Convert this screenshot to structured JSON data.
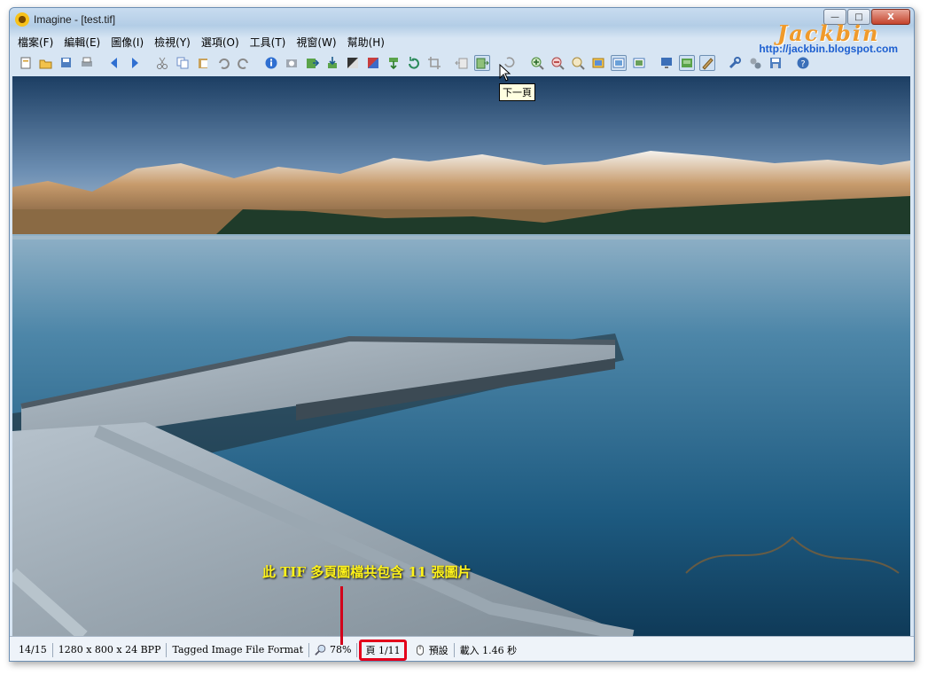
{
  "window": {
    "title": "Imagine - [test.tif]"
  },
  "window_buttons": {
    "minimize": "—",
    "maximize": "□",
    "close": "X"
  },
  "menu": [
    {
      "label": "檔案(F)"
    },
    {
      "label": "編輯(E)"
    },
    {
      "label": "圖像(I)"
    },
    {
      "label": "檢視(Y)"
    },
    {
      "label": "選項(O)"
    },
    {
      "label": "工具(T)"
    },
    {
      "label": "視窗(W)"
    },
    {
      "label": "幫助(H)"
    }
  ],
  "toolbar": {
    "icons": [
      "new-file-icon",
      "open-icon",
      "save-all-icon",
      "print-icon",
      "prev-file-icon",
      "next-file-icon",
      "cut-icon",
      "copy-icon",
      "paste-icon",
      "undo-icon",
      "redo-icon",
      "info-icon",
      "capture-icon",
      "export-icon",
      "import-icon",
      "contrast-icon",
      "color-icon",
      "move-down-icon",
      "rotate-icon",
      "crop-icon",
      "prev-page-icon",
      "next-page-icon",
      "refresh-icon",
      "zoom-in-icon",
      "zoom-out-icon",
      "zoom-fit-icon",
      "view-icon",
      "slideshow-icon",
      "fullscreen-icon",
      "monitor-icon",
      "thumbnail-icon",
      "edit-tool-icon",
      "settings-icon",
      "plugins-icon",
      "save-icon",
      "help-icon"
    ],
    "tooltip": "下一頁"
  },
  "brand": {
    "logo": "Jackbin",
    "url": "http://jackbin.blogspot.com"
  },
  "canvas": {
    "annotation": "此 TIF 多頁圖檔共包含 11 張圖片"
  },
  "status": {
    "file_index": "14/15",
    "dimensions": "1280 x 800 x 24 BPP",
    "format": "Tagged Image File Format",
    "zoom": "78%",
    "page": "頁 1/11",
    "mode": "預設",
    "load_time": "載入 1.46 秒"
  },
  "colors": {
    "annotation": "#fff31a",
    "highlight": "#e3001b",
    "brand_logo": "#f09a2a",
    "brand_url": "#1d5fd0"
  }
}
